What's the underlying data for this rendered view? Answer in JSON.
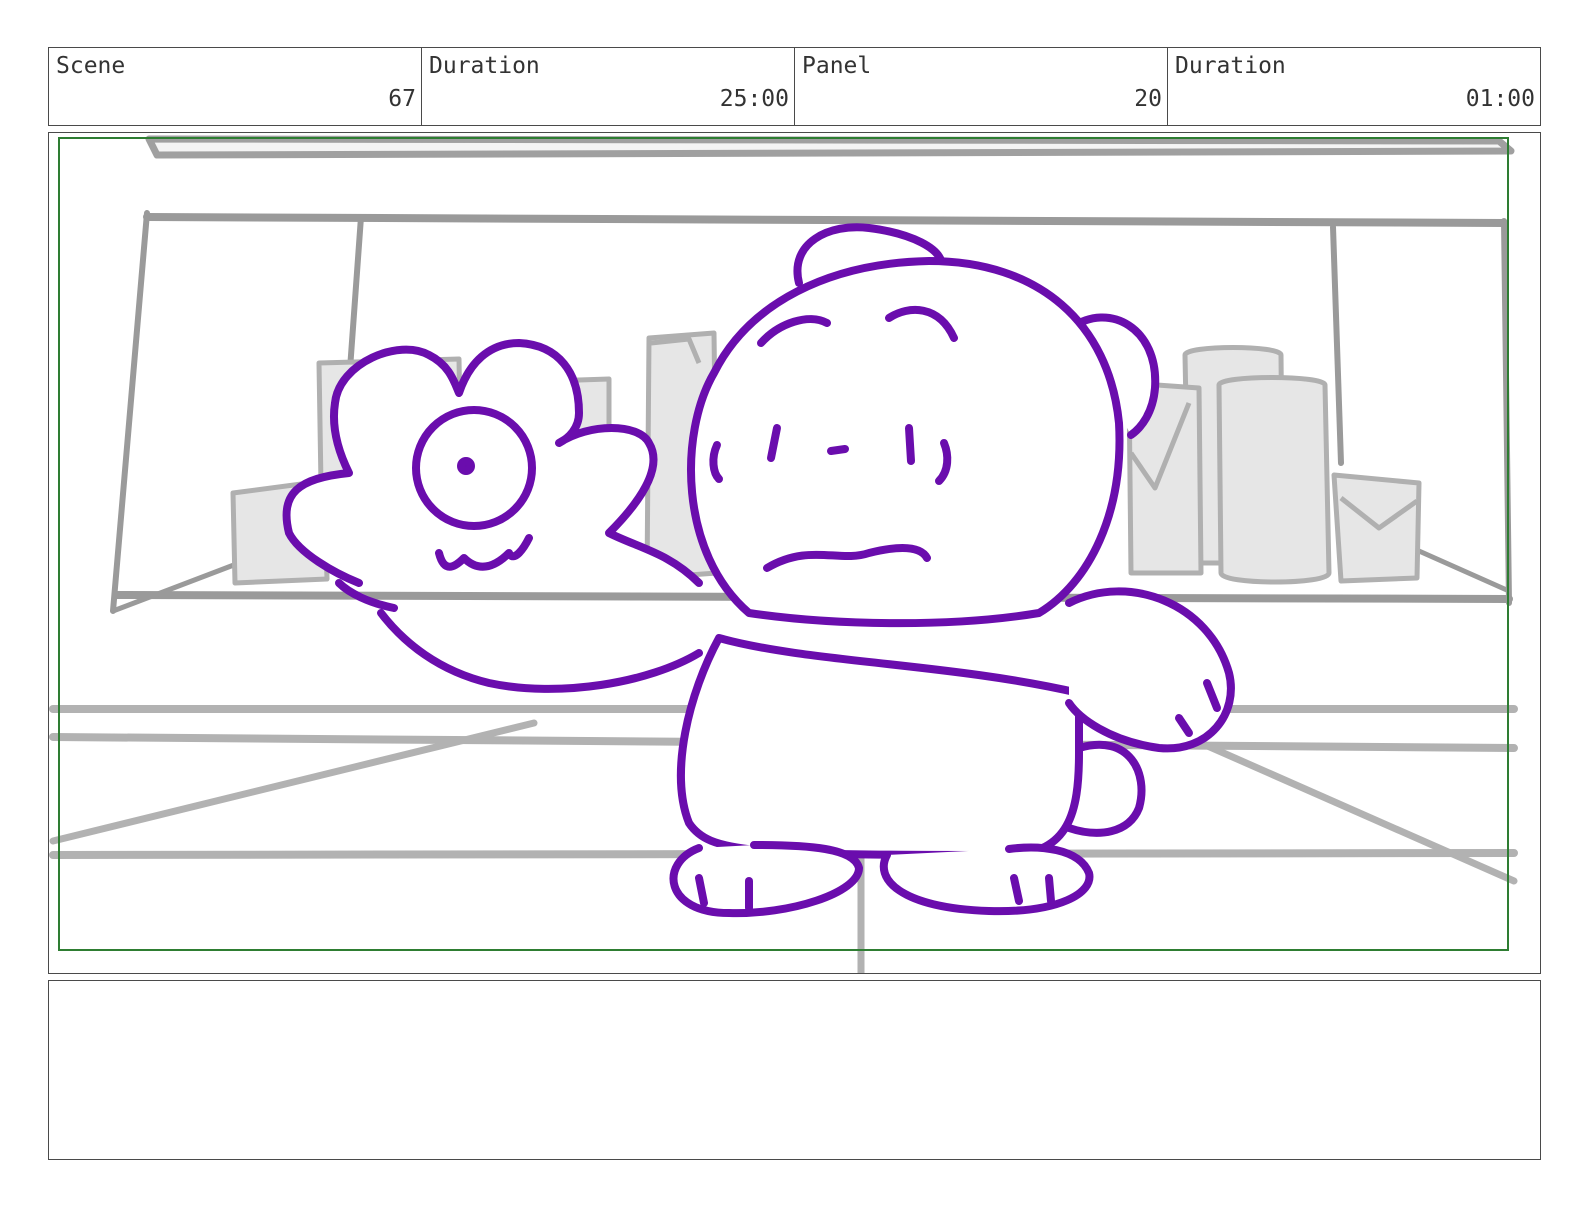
{
  "header": {
    "scene_label": "Scene",
    "scene_value": "67",
    "scene_duration_label": "Duration",
    "scene_duration_value": "25:00",
    "panel_label": "Panel",
    "panel_value": "20",
    "panel_duration_label": "Duration",
    "panel_duration_value": "01:00"
  },
  "colors": {
    "character_line": "#6a0dad",
    "background_line": "#a8a8a8",
    "safe_frame": "#2e7d32"
  },
  "notes": {
    "text": ""
  }
}
